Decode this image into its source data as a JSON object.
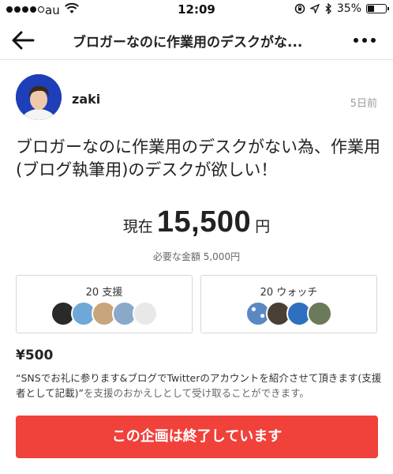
{
  "status_bar": {
    "carrier": "au",
    "time": "12:09",
    "battery": "35%",
    "battery_level": 0.35
  },
  "nav": {
    "title": "ブロガーなのに作業用のデスクがな..."
  },
  "author": {
    "name": "zaki",
    "posted": "5日前"
  },
  "project": {
    "title": "ブロガーなのに作業用のデスクがない為、作業用(ブログ執筆用)のデスクが欲しい！"
  },
  "funding": {
    "current_label": "現在",
    "current_value": "15,500",
    "currency_unit": "円",
    "goal_text": "必要な金額 5,000円"
  },
  "stats": {
    "supporters": "20 支援",
    "watchers": "20 ウォッチ"
  },
  "reward": {
    "price": "¥500",
    "description": "“SNSでお礼に参ります&ブログでTwitterのアカウントを紹介させて頂きます(支援者として記載)”",
    "suffix": "を支援のおかえしとして受け取ることができます。"
  },
  "cta": {
    "label": "この企画は終了しています"
  },
  "colors": {
    "accent": "#f0413b",
    "avatar_bg": "#1f3fb8"
  }
}
